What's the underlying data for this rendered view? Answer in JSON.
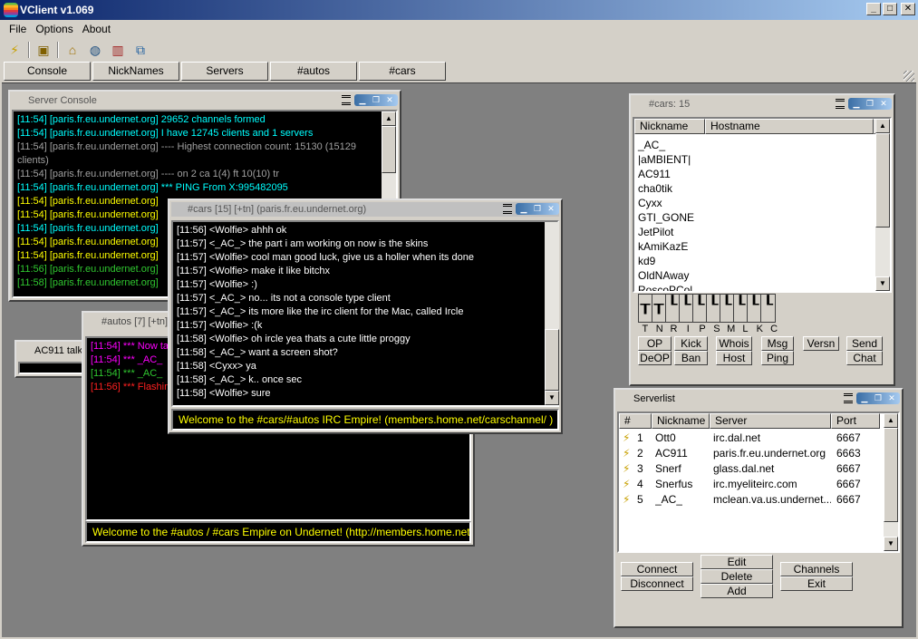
{
  "app": {
    "title": "VClient v1.069"
  },
  "menu": [
    "File",
    "Options",
    "About"
  ],
  "tabs": [
    "Console",
    "NickNames",
    "Servers",
    "#autos",
    "#cars"
  ],
  "server_console": {
    "title": "Server Console",
    "lines": [
      {
        "t": "[11:54] [paris.fr.eu.undernet.org] 29652 channels formed",
        "c": "cyan"
      },
      {
        "t": "[11:54] [paris.fr.eu.undernet.org] I have 12745 clients and 1 servers",
        "c": "cyan"
      },
      {
        "t": "[11:54] [paris.fr.eu.undernet.org] ---- Highest connection count: 15130 (15129",
        "c": "gray"
      },
      {
        "t": "clients)",
        "c": "gray"
      },
      {
        "t": "[11:54] [paris.fr.eu.undernet.org] ---- on 2 ca 1(4) ft 10(10) tr",
        "c": "gray"
      },
      {
        "t": "[11:54] [paris.fr.eu.undernet.org] *** PING From X:995482095",
        "c": "cyan"
      },
      {
        "t": "[11:54] [paris.fr.eu.undernet.org]",
        "c": "yellow"
      },
      {
        "t": "[11:54] [paris.fr.eu.undernet.org]",
        "c": "yellow"
      },
      {
        "t": "[11:54] [paris.fr.eu.undernet.org]",
        "c": "cyan"
      },
      {
        "t": "[11:54] [paris.fr.eu.undernet.org]",
        "c": "yellow"
      },
      {
        "t": "[11:54] [paris.fr.eu.undernet.org]",
        "c": "yellow"
      },
      {
        "t": "[11:56] [paris.fr.eu.undernet.org]",
        "c": "green"
      },
      {
        "t": "[11:58] [paris.fr.eu.undernet.org]",
        "c": "green"
      }
    ]
  },
  "ac911": {
    "title": "AC911 talkin"
  },
  "autos": {
    "title": "#autos [7] [+tn]  (p",
    "lines": [
      {
        "t": "[11:54] *** Now ta",
        "c": "magenta"
      },
      {
        "t": "[11:54] *** _AC_",
        "c": "magenta"
      },
      {
        "t": "[11:54] *** _AC_",
        "c": "green"
      },
      {
        "t": "[11:56] *** Flashin",
        "c": "red"
      }
    ],
    "topic": "Welcome to the #autos / #cars Empire on Undernet! (http://members.home.net/carschannel/"
  },
  "cars": {
    "title": "#cars [15] [+tn]  (paris.fr.eu.undernet.org)",
    "lines": [
      "[11:56] <Wolfie> ahhh ok",
      "[11:57] <_AC_> the part i am working on now is the skins",
      "[11:57] <Wolfie> cool man good luck, give us a holler when its done",
      "[11:57] <Wolfie> make it like bitchx",
      "[11:57] <Wolfie> :)",
      "[11:57] <_AC_> no... its not a console type client",
      "[11:57] <_AC_> its more like the irc client for the Mac, called Ircle",
      "[11:57] <Wolfie> :(k",
      "[11:58] <Wolfie> oh ircle yea thats a cute little proggy",
      "[11:58] <_AC_> want a screen shot?",
      "[11:58] <Cyxx> ya",
      "[11:58] <_AC_> k.. once sec",
      "[11:58] <Wolfie> sure"
    ],
    "topic": "Welcome to the #cars/#autos IRC Empire! (members.home.net/carschannel/ )"
  },
  "nicklist": {
    "title": "#cars: 15",
    "headers": [
      "Nickname",
      "Hostname"
    ],
    "nicks": [
      "_AC_",
      "|aMBIENT|",
      "AC911",
      "cha0tik",
      "Cyxx",
      "GTI_GONE",
      "JetPilot",
      "kAmiKazE",
      "kd9",
      "OldNAway",
      "RoscoPCol"
    ],
    "mode_labels": [
      "T",
      "N",
      "R",
      "I",
      "P",
      "S",
      "M",
      "L",
      "K",
      "C"
    ],
    "buttons": {
      "op": "OP",
      "kick": "Kick",
      "whois": "Whois",
      "msg": "Msg",
      "versn": "Versn",
      "send": "Send",
      "deop": "DeOP",
      "ban": "Ban",
      "host": "Host",
      "ping": "Ping",
      "chat": "Chat"
    }
  },
  "serverlist": {
    "title": "Serverlist",
    "headers": [
      "#",
      "Nickname",
      "Server",
      "Port"
    ],
    "rows": [
      {
        "n": "1",
        "nick": "Ott0",
        "server": "irc.dal.net",
        "port": "6667"
      },
      {
        "n": "2",
        "nick": "AC911",
        "server": "paris.fr.eu.undernet.org",
        "port": "6663"
      },
      {
        "n": "3",
        "nick": "Snerf",
        "server": "glass.dal.net",
        "port": "6667"
      },
      {
        "n": "4",
        "nick": "Snerfus",
        "server": "irc.myeliteirc.com",
        "port": "6667"
      },
      {
        "n": "5",
        "nick": "_AC_",
        "server": "mclean.va.us.undernet...",
        "port": "6667"
      }
    ],
    "buttons": {
      "connect": "Connect",
      "disconnect": "Disconnect",
      "edit": "Edit",
      "delete": "Delete",
      "add": "Add",
      "channels": "Channels",
      "exit": "Exit"
    }
  }
}
